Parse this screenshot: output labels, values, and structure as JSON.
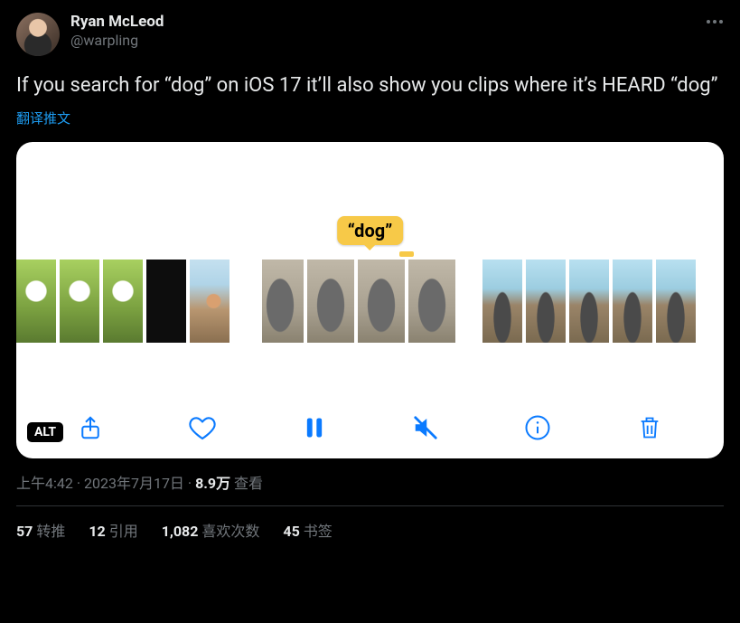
{
  "header": {
    "display_name": "Ryan McLeod",
    "handle": "@warpling"
  },
  "tweet_text": "If you search for “dog” on iOS 17 it’ll also show you clips where it’s HEARD “dog”",
  "translate_label": "翻译推文",
  "media": {
    "search_tag": "“dog”",
    "alt_label": "ALT"
  },
  "meta": {
    "time": "上午4:42",
    "date": "2023年7月17日",
    "views_count": "8.9万",
    "views_label": "查看",
    "separator": " · "
  },
  "stats": {
    "retweets_count": "57",
    "retweets_label": "转推",
    "quotes_count": "12",
    "quotes_label": "引用",
    "likes_count": "1,082",
    "likes_label": "喜欢次数",
    "bookmarks_count": "45",
    "bookmarks_label": "书签"
  }
}
